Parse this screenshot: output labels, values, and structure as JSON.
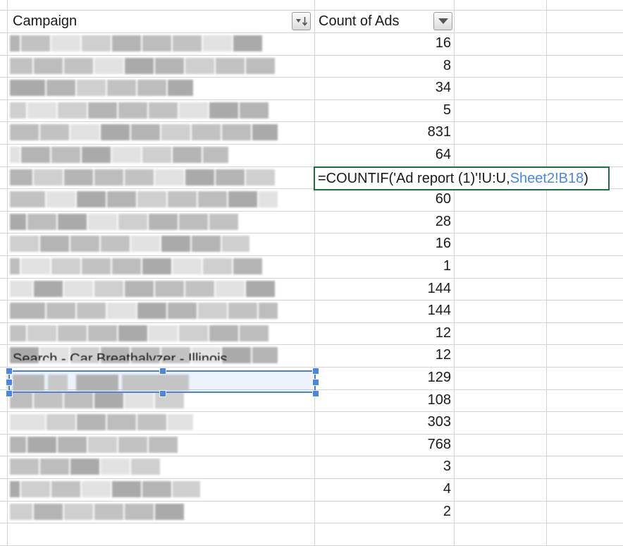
{
  "header": {
    "campaign_label": "Campaign",
    "count_label": "Count of Ads",
    "sort_filter_icon": "sort-filter-icon",
    "dropdown_icon": "dropdown-arrow-icon"
  },
  "rows": [
    {
      "count": "16"
    },
    {
      "count": "8"
    },
    {
      "count": "34"
    },
    {
      "count": "5"
    },
    {
      "count": "831"
    },
    {
      "count": "64"
    },
    {
      "count": "=COUNTIF('Ad report (1)'!U:U,Sheet2!B18)"
    },
    {
      "count": "60"
    },
    {
      "count": "28"
    },
    {
      "count": "16"
    },
    {
      "count": "1"
    },
    {
      "count": "144"
    },
    {
      "count": "144"
    },
    {
      "count": "12"
    },
    {
      "count": "12"
    },
    {
      "count": "129"
    },
    {
      "count": "108"
    },
    {
      "count": "303"
    },
    {
      "count": "768"
    },
    {
      "count": "3"
    },
    {
      "count": "4"
    },
    {
      "count": "2"
    }
  ],
  "formula": {
    "prefix": "=COUNTIF('Ad report (1)'!U:U,",
    "reference": "Sheet2!B18",
    "suffix": ")"
  },
  "colors": {
    "active_cell_border": "#1f6e43",
    "reference_text": "#4a86e8",
    "selection_border": "#4a7fd4",
    "gridline": "#d4d4d4"
  }
}
